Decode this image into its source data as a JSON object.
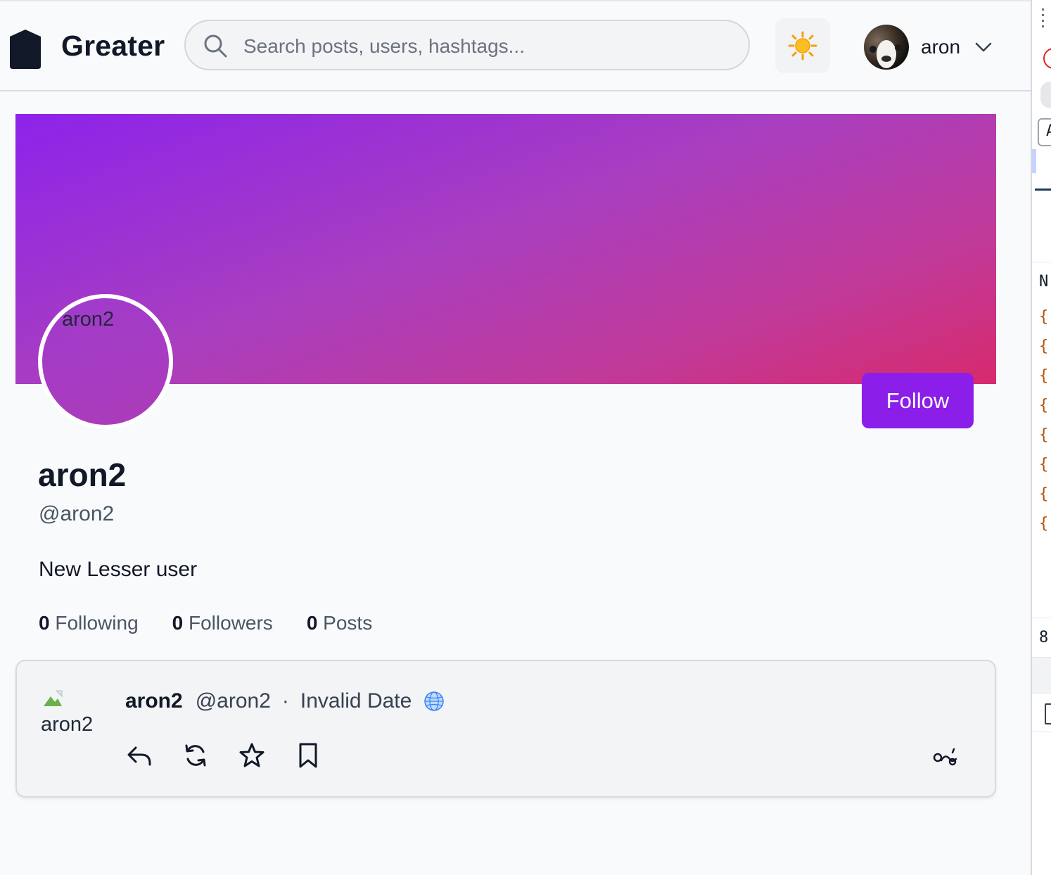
{
  "header": {
    "brand": "Greater",
    "search_placeholder": "Search posts, users, hashtags...",
    "theme_icon": "sun-icon",
    "user_name": "aron"
  },
  "profile": {
    "avatar_alt": "aron2",
    "display_name": "aron2",
    "handle": "@aron2",
    "bio": "New Lesser user",
    "follow_label": "Follow",
    "stats": [
      {
        "count": "0",
        "label": "Following"
      },
      {
        "count": "0",
        "label": "Followers"
      },
      {
        "count": "0",
        "label": "Posts"
      }
    ]
  },
  "post": {
    "avatar_alt": "aron2",
    "author_name": "aron2",
    "author_handle": "@aron2",
    "separator": "·",
    "date": "Invalid Date",
    "visibility_icon": "globe-icon",
    "actions": [
      "reply-icon",
      "boost-icon",
      "favorite-icon",
      "bookmark-icon"
    ],
    "more_icon": "more-icon"
  },
  "devtools": {
    "letters": [
      "A",
      "N",
      "8"
    ]
  },
  "colors": {
    "accent": "#8b1ee8",
    "banner_start": "#8d23ea",
    "banner_end": "#d72a6e"
  }
}
